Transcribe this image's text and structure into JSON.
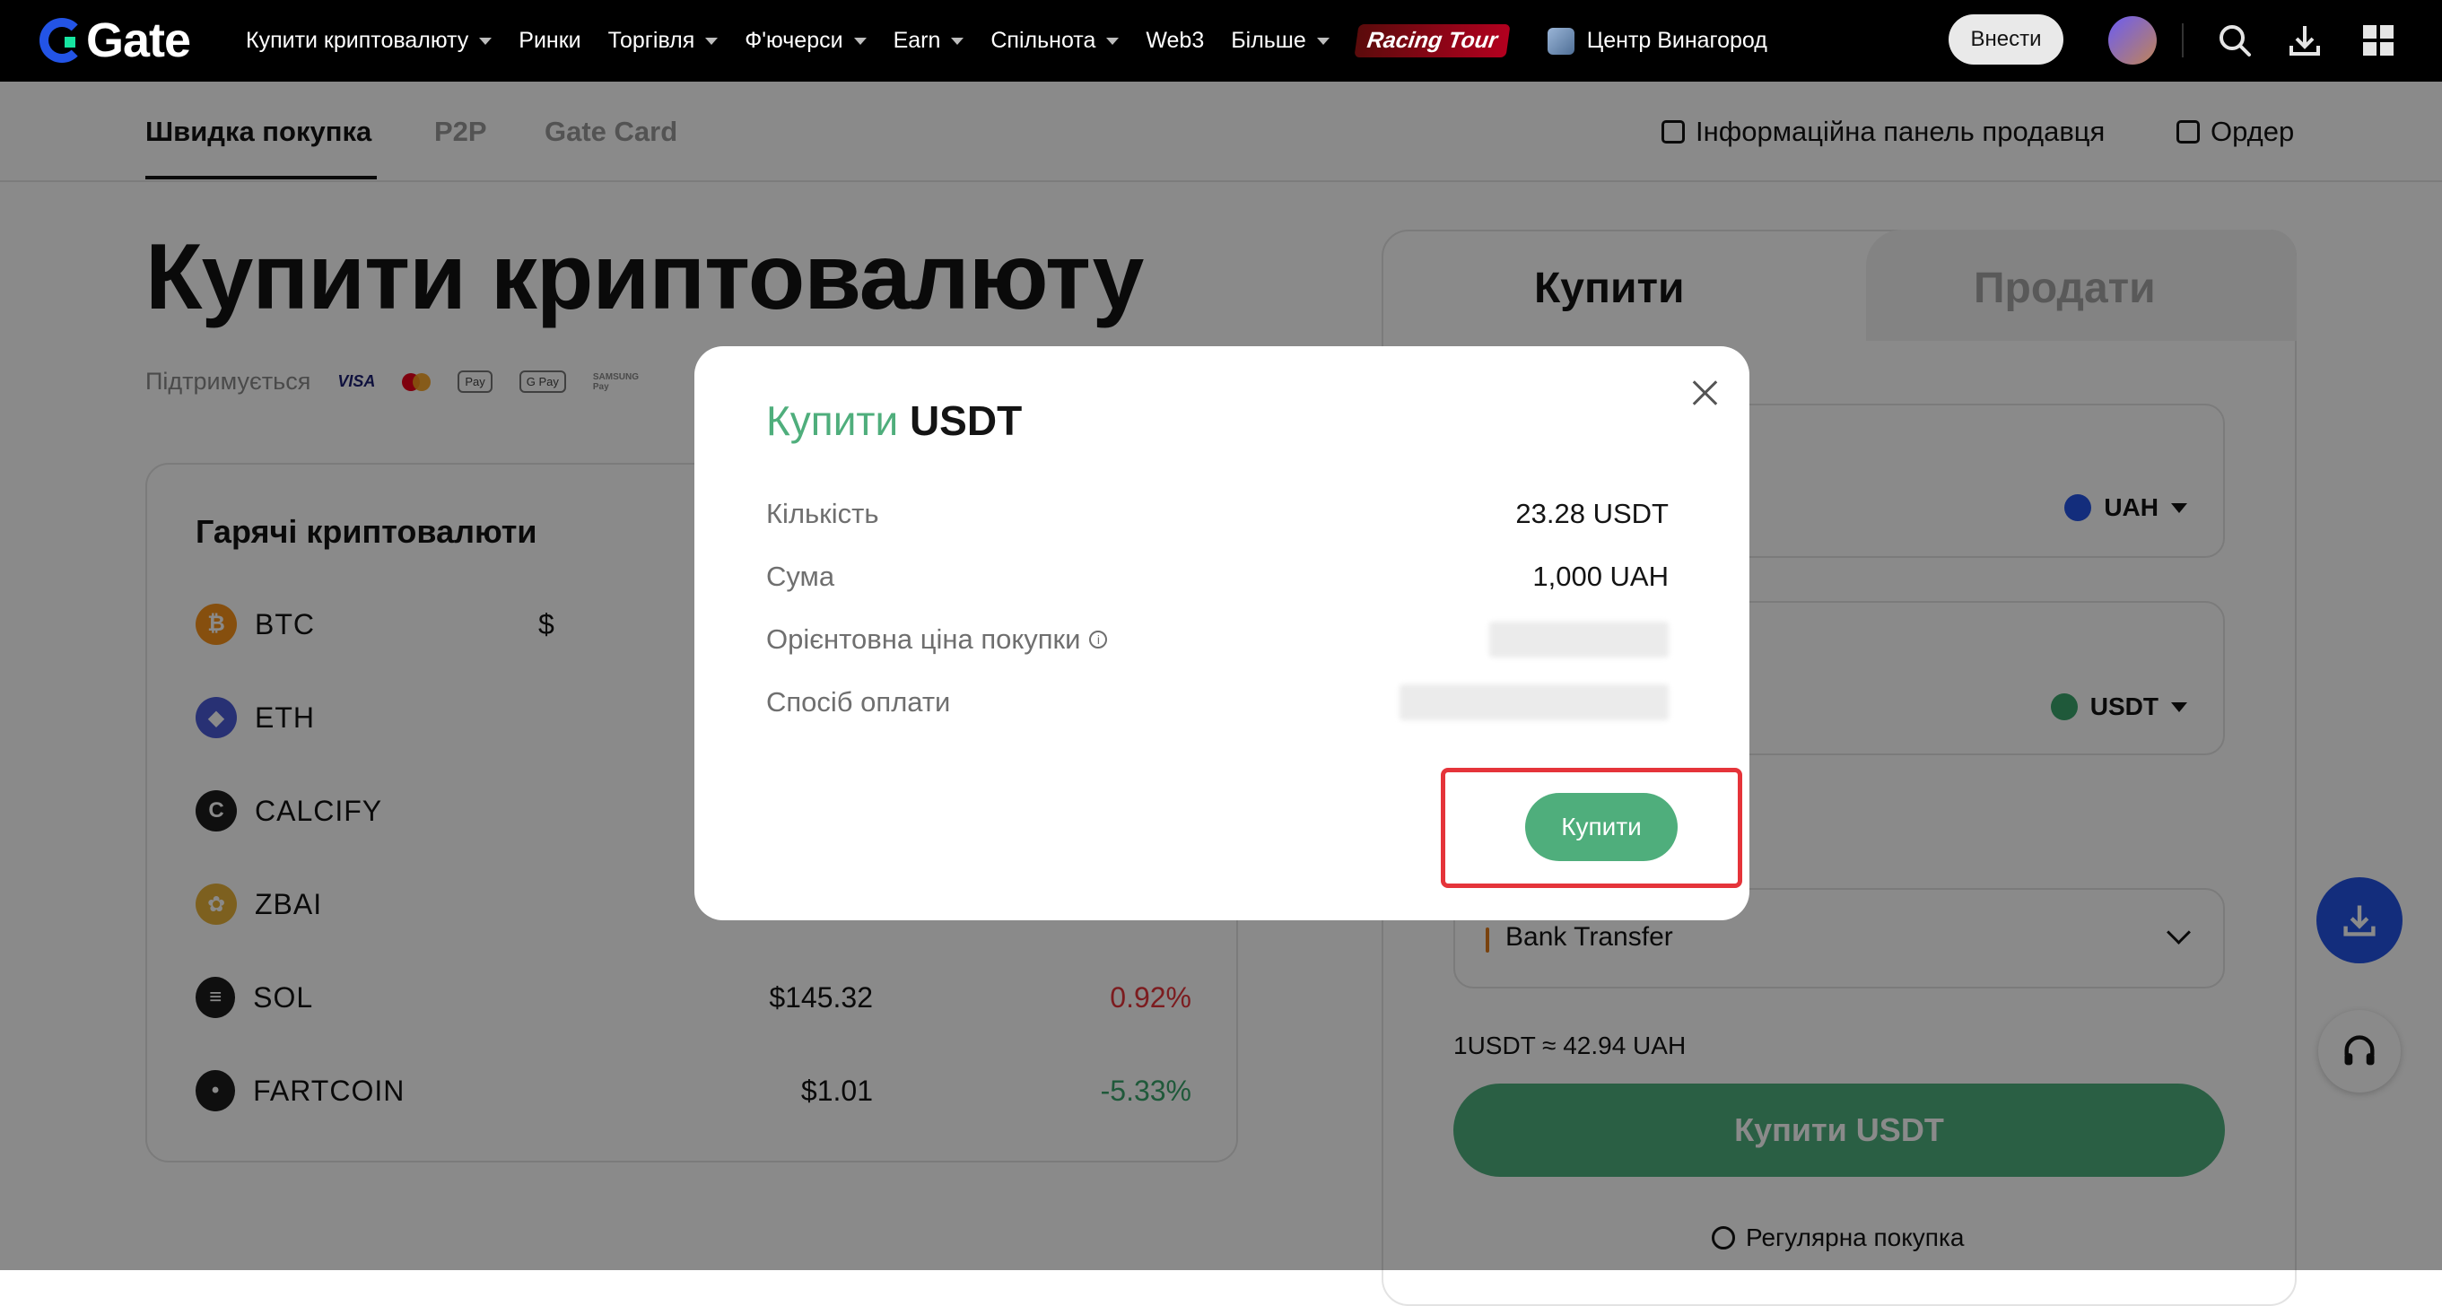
{
  "topnav": {
    "logo_text": "Gate",
    "items": [
      {
        "label": "Купити криптовалюту",
        "caret": true
      },
      {
        "label": "Ринки",
        "caret": false
      },
      {
        "label": "Торгівля",
        "caret": true
      },
      {
        "label": "Ф'ючерси",
        "caret": true
      },
      {
        "label": "Earn",
        "caret": true
      },
      {
        "label": "Спільнота",
        "caret": true
      },
      {
        "label": "Web3",
        "caret": false
      },
      {
        "label": "Більше",
        "caret": true
      }
    ],
    "racing_label": "Racing Tour",
    "center_label": "Центр Винагород",
    "login_label": "Внести"
  },
  "subnav": {
    "tabs": [
      "Швидка покупка",
      "P2P",
      "Gate Card"
    ],
    "seller_panel": "Інформаційна панель продавця",
    "order": "Ордер"
  },
  "page": {
    "title": "Купити криптовалюту",
    "supported_label": "Підтримується",
    "payment_logos": [
      "VISA",
      "Pay",
      "G Pay",
      "SAMSUNG Pay"
    ]
  },
  "hot": {
    "title": "Гарячі криптовалюти",
    "coins": [
      {
        "name": "BTC",
        "price": "$",
        "change": "",
        "color": "#f7931a",
        "letter": "₿"
      },
      {
        "name": "ETH",
        "price": "",
        "change": "",
        "color": "#4b5bd6",
        "letter": "◆"
      },
      {
        "name": "CALCIFY",
        "price": "",
        "change": "",
        "color": "#1c1c1c",
        "letter": "C"
      },
      {
        "name": "ZBAI",
        "price": "",
        "change": "",
        "color": "#e8b23a",
        "letter": "✿"
      },
      {
        "name": "SOL",
        "price": "$145.32",
        "change": "0.92%",
        "change_color": "#e5343a",
        "color": "#1c1c1c",
        "letter": "≡"
      },
      {
        "name": "FARTCOIN",
        "price": "$1.01",
        "change": "-5.33%",
        "change_color": "#3aa56b",
        "color": "#1c1c1c",
        "letter": "•"
      }
    ]
  },
  "trade": {
    "tab_buy": "Купити",
    "tab_sell": "Продати",
    "spend_currency": "UAH",
    "receive_currency": "USDT",
    "payment_method": "Bank Transfer",
    "rate": "1USDT ≈ 42.94 UAH",
    "buy_button": "Купити USDT",
    "recurring": "Регулярна покупка"
  },
  "modal": {
    "title_prefix": "Купити",
    "title_asset": "USDT",
    "rows": [
      {
        "label": "Кількість",
        "value": "23.28 USDT"
      },
      {
        "label": "Сума",
        "value": "1,000 UAH"
      },
      {
        "label": "Орієнтовна ціна покупки",
        "value": ""
      },
      {
        "label": "Спосіб оплати",
        "value": ""
      }
    ],
    "buy_button": "Купити"
  },
  "colors": {
    "brand_blue": "#2354e6",
    "buy_green": "#4fae7c",
    "highlight_red": "#e5343a",
    "loss_red": "#e5343a",
    "gain_green": "#3aa56b"
  }
}
